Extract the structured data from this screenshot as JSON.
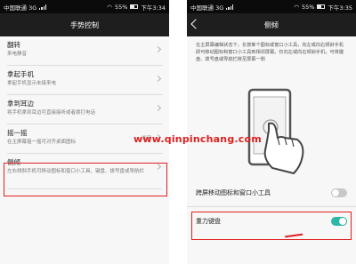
{
  "left": {
    "status": {
      "carrier": "中国联通 3G",
      "battery": "55%",
      "time": "下午3:34"
    },
    "title": "手势控制",
    "items": [
      {
        "title": "翻转",
        "sub": "来电静音",
        "value": ""
      },
      {
        "title": "拿起手机",
        "sub": "拿起手机显示未接来电",
        "value": ""
      },
      {
        "title": "拿到耳边",
        "sub": "将手机拿到耳边可直接接听或者拨打电话",
        "value": ""
      },
      {
        "title": "摇一摇",
        "sub": "在主屏幕摇一摇可对齐桌面图标",
        "value": "关闭"
      },
      {
        "title": "侧倾",
        "sub": "左右倾斜手机可移动图标和窗口小工具、键盘、拨号盘或导航栏",
        "value": ""
      }
    ]
  },
  "right": {
    "status": {
      "carrier": "中国联通 3G",
      "battery": "55%",
      "time": "下午3:35"
    },
    "title": "侧倾",
    "description": "在主屏幕编辑状态下，长按某个图标或窗口小工具，向左或向右倾斜手机即可移动图标和窗口小工具到相邻屏幕。仅向左或向右倾斜手机，可将键盘、拨号盘或导航栏移至屏幕一侧",
    "rows": [
      {
        "title": "跨屏移动图标和窗口小工具",
        "sub": "",
        "on": false
      },
      {
        "title": "重力键盘",
        "sub": "",
        "on": true
      }
    ]
  },
  "watermark": "www.qinpinchang.com",
  "colors": {
    "highlight": "#e02020",
    "toggle_on": "#2db7a7",
    "toggle_off": "#c8c8c8",
    "titlebar": "#1e1e1e"
  }
}
